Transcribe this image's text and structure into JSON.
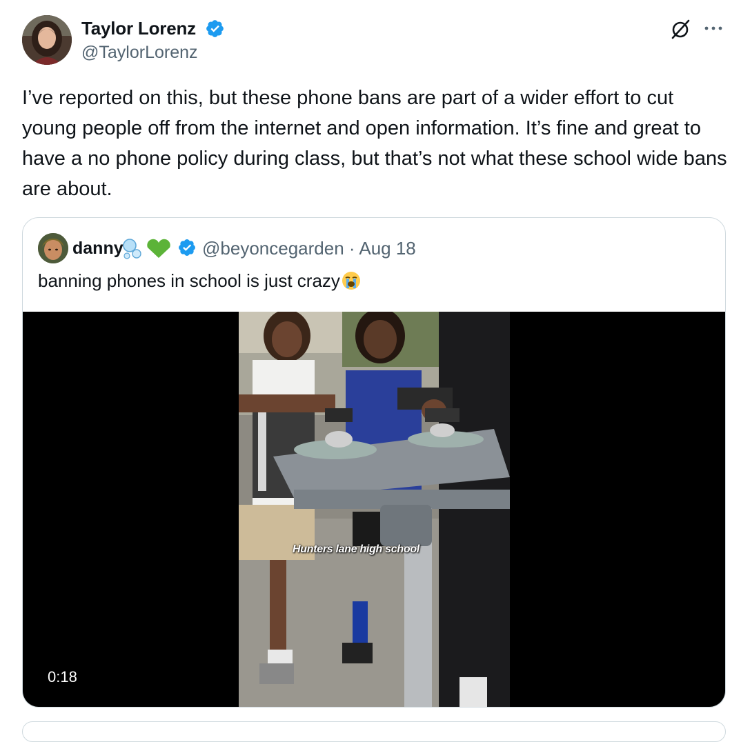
{
  "author": {
    "name": "Taylor Lorenz",
    "handle": "@TaylorLorenz",
    "verified": true
  },
  "tweet": {
    "text": "I’ve reported on this, but these phone bans are part of a wider effort to cut young people off from the internet and open information. It’s fine and great to have a no phone policy during class, but that’s not what these school wide bans are about."
  },
  "quoted": {
    "name": "danny",
    "name_emojis": [
      "bubbles-emoji",
      "green-heart-emoji"
    ],
    "handle": "@beyoncegarden",
    "separator": "·",
    "date": "Aug 18",
    "text": "banning phones in school is just crazy",
    "text_emoji": "loudly-crying-face-emoji",
    "video": {
      "caption": "Hunters lane high school",
      "duration": "0:18"
    }
  },
  "colors": {
    "text_primary": "#0f1419",
    "text_secondary": "#536471",
    "verified_blue": "#1d9bf0",
    "border": "#cfd9de",
    "video_bg": "#000000"
  },
  "icons": [
    "grok-icon",
    "more-icon",
    "verified-badge-icon"
  ]
}
